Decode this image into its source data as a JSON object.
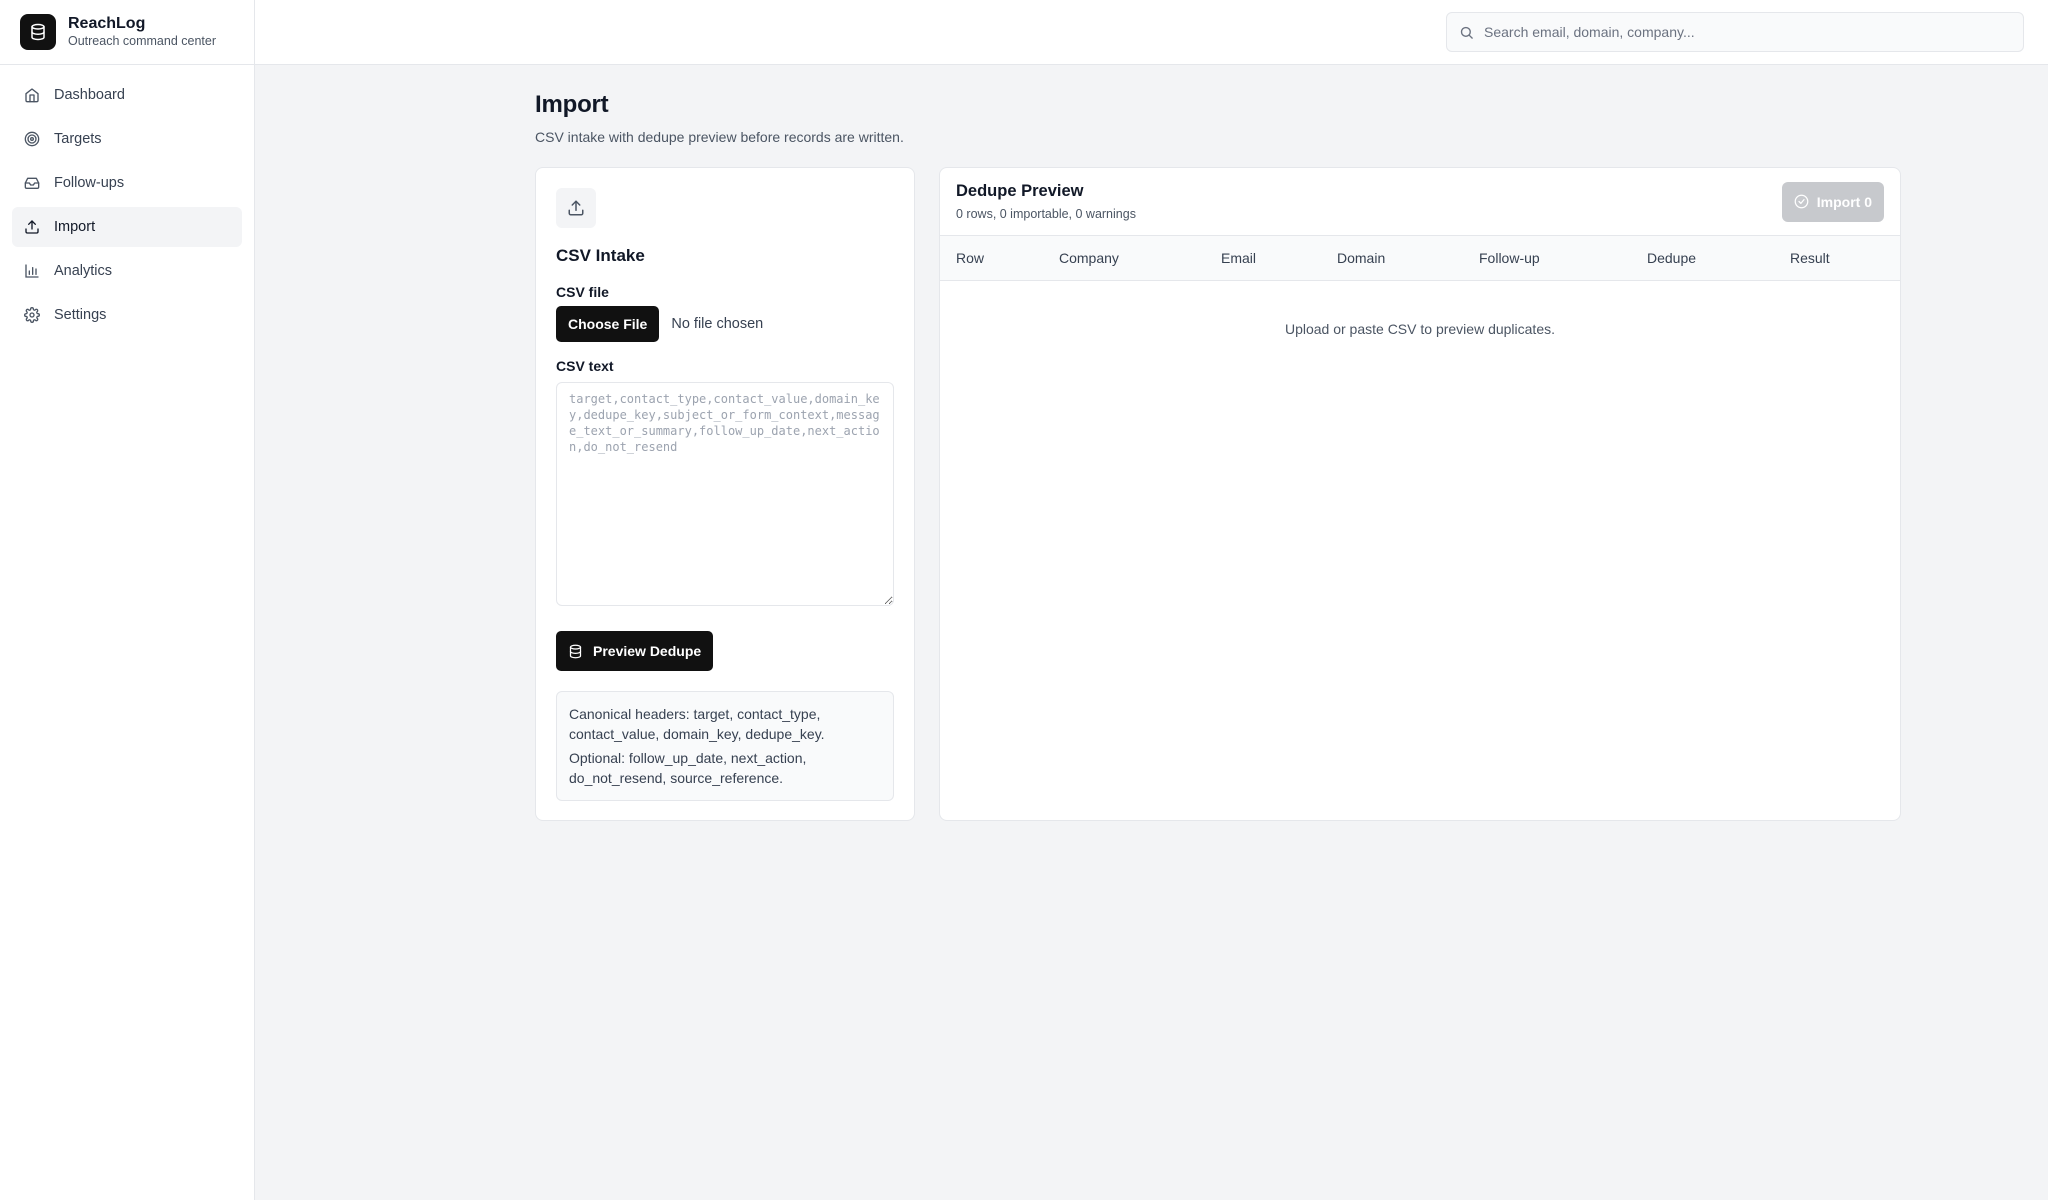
{
  "brand": {
    "name": "ReachLog",
    "tagline": "Outreach command center",
    "logo_icon": "database-icon"
  },
  "nav": {
    "items": [
      {
        "label": "Dashboard",
        "icon": "home-icon",
        "active": false
      },
      {
        "label": "Targets",
        "icon": "target-icon",
        "active": false
      },
      {
        "label": "Follow-ups",
        "icon": "inbox-icon",
        "active": false
      },
      {
        "label": "Import",
        "icon": "upload-icon",
        "active": true
      },
      {
        "label": "Analytics",
        "icon": "bar-chart-icon",
        "active": false
      },
      {
        "label": "Settings",
        "icon": "gear-icon",
        "active": false
      }
    ]
  },
  "search": {
    "placeholder": "Search email, domain, company..."
  },
  "page": {
    "title": "Import",
    "subtitle": "CSV intake with dedupe preview before records are written."
  },
  "intake": {
    "title": "CSV Intake",
    "file_label": "CSV file",
    "choose_label": "Choose File",
    "file_status": "No file chosen",
    "text_label": "CSV text",
    "text_value": "",
    "text_placeholder": "target,contact_type,contact_value,domain_key,dedupe_key,subject_or_form_context,message_text_or_summary,follow_up_date,next_action,do_not_resend",
    "preview_label": "Preview Dedupe",
    "hint_required": "Canonical headers: target, contact_type, contact_value, domain_key, dedupe_key.",
    "hint_optional": "Optional: follow_up_date, next_action, do_not_resend, source_reference."
  },
  "dedupe": {
    "title": "Dedupe Preview",
    "summary": "0 rows, 0 importable, 0 warnings",
    "import_label": "Import 0",
    "columns": [
      "Row",
      "Company",
      "Email",
      "Domain",
      "Follow-up",
      "Dedupe",
      "Result"
    ],
    "empty_message": "Upload or paste CSV to preview duplicates."
  },
  "colors": {
    "primary": "#111111",
    "border": "#e5e7eb",
    "background": "#f3f4f6",
    "disabled": "#c7c9cd"
  }
}
